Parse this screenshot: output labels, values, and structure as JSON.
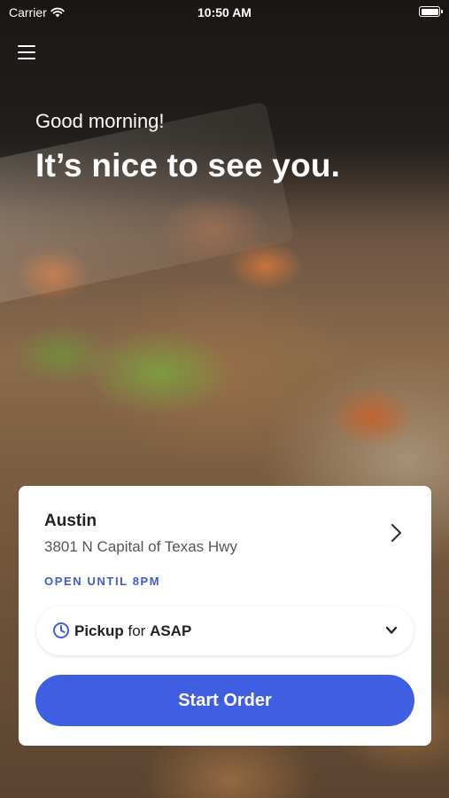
{
  "status_bar": {
    "carrier": "Carrier",
    "time": "10:50 AM"
  },
  "header": {
    "menu_icon": "hamburger-menu-icon",
    "greeting": "Good morning!",
    "headline": "It’s nice to see you."
  },
  "location_card": {
    "name": "Austin",
    "address": "3801 N Capital of Texas Hwy",
    "status": "OPEN UNTIL 8PM",
    "pickup": {
      "mode": "Pickup",
      "connector": "for",
      "time": "ASAP"
    },
    "start_order_label": "Start Order"
  },
  "colors": {
    "accent": "#3f5ee2",
    "status_text": "#3d5bd9",
    "card_background": "#ffffff"
  }
}
